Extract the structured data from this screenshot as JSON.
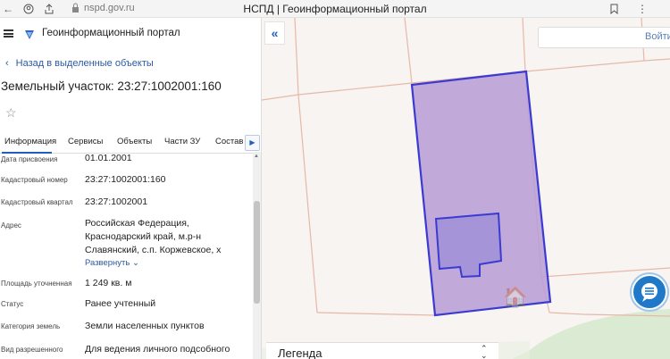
{
  "browser": {
    "url": "nspd.gov.ru",
    "window_title": "НСПД | Геоинформационный портал"
  },
  "header": {
    "portal_title": "Геоинформационный портал"
  },
  "back_link": "Назад в выделенные объекты",
  "parcel": {
    "title": "Земельный участок: 23:27:1002001:160"
  },
  "tabs": [
    {
      "label": "Информация"
    },
    {
      "label": "Сервисы"
    },
    {
      "label": "Объекты"
    },
    {
      "label": "Части ЗУ"
    },
    {
      "label": "Состав"
    }
  ],
  "fields": [
    {
      "label": "Дата присвоения",
      "value": "01.01.2001"
    },
    {
      "label": "Кадастровый номер",
      "value": "23:27:1002001:160"
    },
    {
      "label": "Кадастровый квартал",
      "value": "23:27:1002001"
    },
    {
      "label": "Адрес",
      "value_lines": [
        "Российская Федерация,",
        "Краснодарский край, м.р-н",
        "Славянский, с.п. Коржевское, х"
      ]
    },
    {
      "label": "Площадь уточненная",
      "value": "1 249 кв. м"
    },
    {
      "label": "Статус",
      "value": "Ранее учтенный"
    },
    {
      "label": "Категория земель",
      "value": "Земли населенных пунктов"
    },
    {
      "label": "Вид разрешенного",
      "value": "Для ведения личного подсобного"
    }
  ],
  "expand_label": "Развернуть",
  "map": {
    "search_button_label": "Войти",
    "legend_label": "Легенда",
    "parcel_fill_color": "#b79cd6",
    "parcel_stroke_color": "#3b3bd1",
    "cadastral_grid_color": "#e7b8a8"
  }
}
